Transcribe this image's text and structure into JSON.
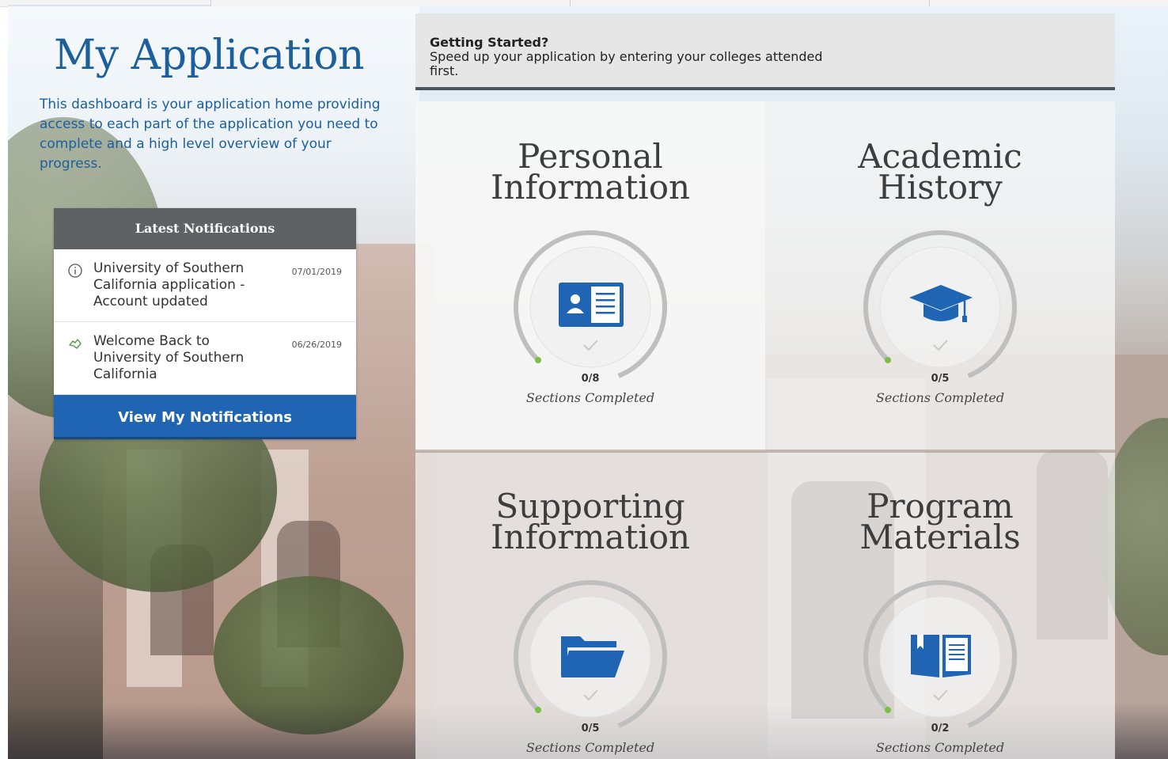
{
  "page": {
    "title": "My Application",
    "intro": "This dashboard is your application home providing access to each part of the application you need to complete and a high level overview of your progress."
  },
  "notifications": {
    "header": "Latest Notifications",
    "items": [
      {
        "icon": "info-icon",
        "message": "University of Southern California application - Account updated",
        "date": "07/01/2019"
      },
      {
        "icon": "handshake-icon",
        "message": "Welcome Back to University of Southern California",
        "date": "06/26/2019"
      }
    ],
    "button_label": "View My Notifications"
  },
  "getting_started": {
    "title": "Getting Started?",
    "body": "Speed up your application by entering your colleges attended first."
  },
  "tiles": [
    {
      "title_line1": "Personal",
      "title_line2": "Information",
      "icon": "id-card-icon",
      "completed": 0,
      "total": 8,
      "count": "0/8",
      "label": "Sections Completed"
    },
    {
      "title_line1": "Academic",
      "title_line2": "History",
      "icon": "graduation-cap-icon",
      "completed": 0,
      "total": 5,
      "count": "0/5",
      "label": "Sections Completed"
    },
    {
      "title_line1": "Supporting",
      "title_line2": "Information",
      "icon": "folder-icon",
      "completed": 0,
      "total": 5,
      "count": "0/5",
      "label": "Sections Completed"
    },
    {
      "title_line1": "Program",
      "title_line2": "Materials",
      "icon": "book-icon",
      "completed": 0,
      "total": 2,
      "count": "0/2",
      "label": "Sections Completed"
    }
  ],
  "colors": {
    "brand_blue": "#1f65b3",
    "title_blue": "#1d5f9c",
    "header_gray": "#5e6265",
    "progress_dot": "#7ac143"
  }
}
